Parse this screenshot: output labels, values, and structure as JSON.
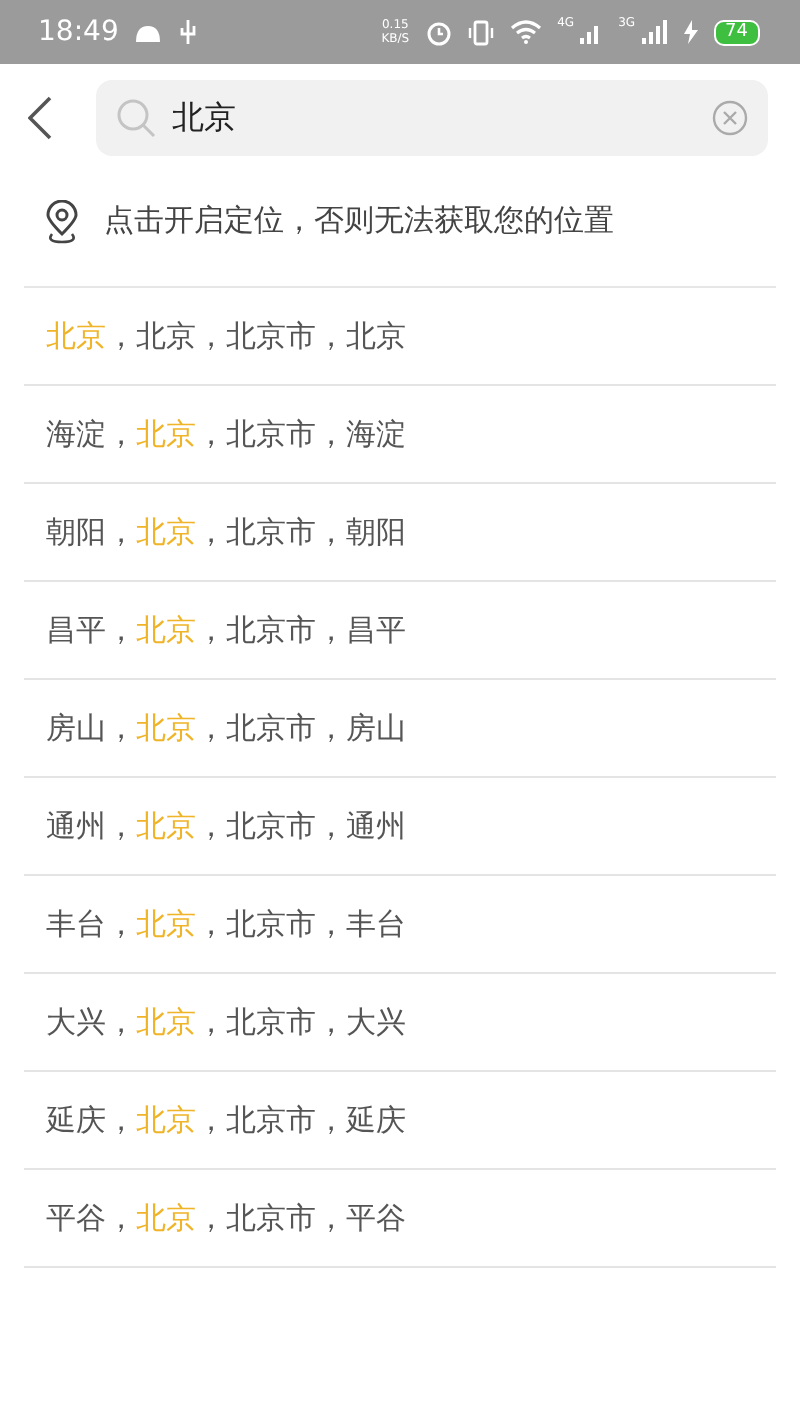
{
  "status_bar": {
    "time": "18:49",
    "speed_value": "0.15",
    "speed_unit": "KB/S",
    "network_1": "4G",
    "network_2": "3G",
    "battery": "74",
    "charging": true
  },
  "search": {
    "value": "北京"
  },
  "location_prompt": "点击开启定位，否则无法获取您的位置",
  "results": [
    [
      {
        "text": "北京",
        "highlighted": true
      },
      {
        "text": "，北京，北京市，北京",
        "highlighted": false
      }
    ],
    [
      {
        "text": "海淀，",
        "highlighted": false
      },
      {
        "text": "北京",
        "highlighted": true
      },
      {
        "text": "，北京市，海淀",
        "highlighted": false
      }
    ],
    [
      {
        "text": "朝阳，",
        "highlighted": false
      },
      {
        "text": "北京",
        "highlighted": true
      },
      {
        "text": "，北京市，朝阳",
        "highlighted": false
      }
    ],
    [
      {
        "text": "昌平，",
        "highlighted": false
      },
      {
        "text": "北京",
        "highlighted": true
      },
      {
        "text": "，北京市，昌平",
        "highlighted": false
      }
    ],
    [
      {
        "text": "房山，",
        "highlighted": false
      },
      {
        "text": "北京",
        "highlighted": true
      },
      {
        "text": "，北京市，房山",
        "highlighted": false
      }
    ],
    [
      {
        "text": "通州，",
        "highlighted": false
      },
      {
        "text": "北京",
        "highlighted": true
      },
      {
        "text": "，北京市，通州",
        "highlighted": false
      }
    ],
    [
      {
        "text": "丰台，",
        "highlighted": false
      },
      {
        "text": "北京",
        "highlighted": true
      },
      {
        "text": "，北京市，丰台",
        "highlighted": false
      }
    ],
    [
      {
        "text": "大兴，",
        "highlighted": false
      },
      {
        "text": "北京",
        "highlighted": true
      },
      {
        "text": "，北京市，大兴",
        "highlighted": false
      }
    ],
    [
      {
        "text": "延庆，",
        "highlighted": false
      },
      {
        "text": "北京",
        "highlighted": true
      },
      {
        "text": "，北京市，延庆",
        "highlighted": false
      }
    ],
    [
      {
        "text": "平谷，",
        "highlighted": false
      },
      {
        "text": "北京",
        "highlighted": true
      },
      {
        "text": "，北京市，平谷",
        "highlighted": false
      }
    ]
  ]
}
